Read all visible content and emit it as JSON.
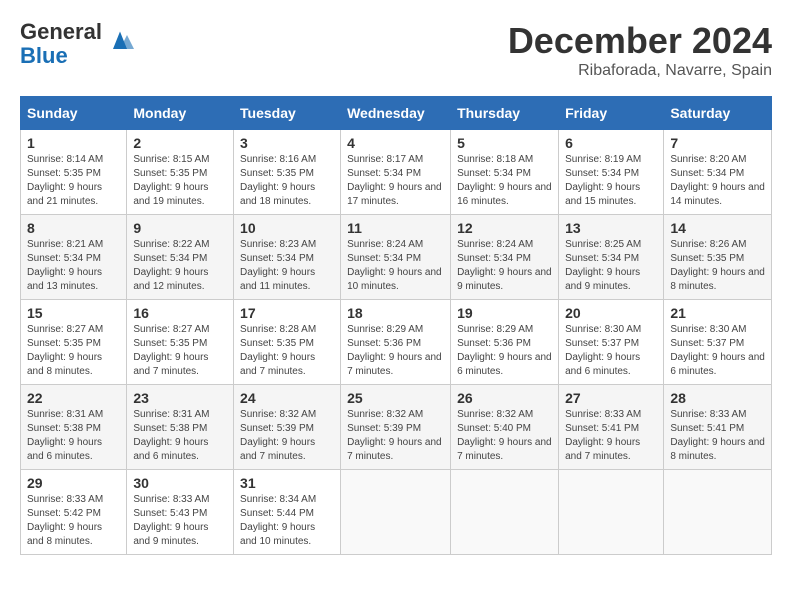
{
  "logo": {
    "general": "General",
    "blue": "Blue"
  },
  "title": "December 2024",
  "location": "Ribaforada, Navarre, Spain",
  "days_of_week": [
    "Sunday",
    "Monday",
    "Tuesday",
    "Wednesday",
    "Thursday",
    "Friday",
    "Saturday"
  ],
  "weeks": [
    [
      {
        "day": "1",
        "sunrise": "8:14 AM",
        "sunset": "5:35 PM",
        "daylight": "9 hours and 21 minutes."
      },
      {
        "day": "2",
        "sunrise": "8:15 AM",
        "sunset": "5:35 PM",
        "daylight": "9 hours and 19 minutes."
      },
      {
        "day": "3",
        "sunrise": "8:16 AM",
        "sunset": "5:35 PM",
        "daylight": "9 hours and 18 minutes."
      },
      {
        "day": "4",
        "sunrise": "8:17 AM",
        "sunset": "5:34 PM",
        "daylight": "9 hours and 17 minutes."
      },
      {
        "day": "5",
        "sunrise": "8:18 AM",
        "sunset": "5:34 PM",
        "daylight": "9 hours and 16 minutes."
      },
      {
        "day": "6",
        "sunrise": "8:19 AM",
        "sunset": "5:34 PM",
        "daylight": "9 hours and 15 minutes."
      },
      {
        "day": "7",
        "sunrise": "8:20 AM",
        "sunset": "5:34 PM",
        "daylight": "9 hours and 14 minutes."
      }
    ],
    [
      {
        "day": "8",
        "sunrise": "8:21 AM",
        "sunset": "5:34 PM",
        "daylight": "9 hours and 13 minutes."
      },
      {
        "day": "9",
        "sunrise": "8:22 AM",
        "sunset": "5:34 PM",
        "daylight": "9 hours and 12 minutes."
      },
      {
        "day": "10",
        "sunrise": "8:23 AM",
        "sunset": "5:34 PM",
        "daylight": "9 hours and 11 minutes."
      },
      {
        "day": "11",
        "sunrise": "8:24 AM",
        "sunset": "5:34 PM",
        "daylight": "9 hours and 10 minutes."
      },
      {
        "day": "12",
        "sunrise": "8:24 AM",
        "sunset": "5:34 PM",
        "daylight": "9 hours and 9 minutes."
      },
      {
        "day": "13",
        "sunrise": "8:25 AM",
        "sunset": "5:34 PM",
        "daylight": "9 hours and 9 minutes."
      },
      {
        "day": "14",
        "sunrise": "8:26 AM",
        "sunset": "5:35 PM",
        "daylight": "9 hours and 8 minutes."
      }
    ],
    [
      {
        "day": "15",
        "sunrise": "8:27 AM",
        "sunset": "5:35 PM",
        "daylight": "9 hours and 8 minutes."
      },
      {
        "day": "16",
        "sunrise": "8:27 AM",
        "sunset": "5:35 PM",
        "daylight": "9 hours and 7 minutes."
      },
      {
        "day": "17",
        "sunrise": "8:28 AM",
        "sunset": "5:35 PM",
        "daylight": "9 hours and 7 minutes."
      },
      {
        "day": "18",
        "sunrise": "8:29 AM",
        "sunset": "5:36 PM",
        "daylight": "9 hours and 7 minutes."
      },
      {
        "day": "19",
        "sunrise": "8:29 AM",
        "sunset": "5:36 PM",
        "daylight": "9 hours and 6 minutes."
      },
      {
        "day": "20",
        "sunrise": "8:30 AM",
        "sunset": "5:37 PM",
        "daylight": "9 hours and 6 minutes."
      },
      {
        "day": "21",
        "sunrise": "8:30 AM",
        "sunset": "5:37 PM",
        "daylight": "9 hours and 6 minutes."
      }
    ],
    [
      {
        "day": "22",
        "sunrise": "8:31 AM",
        "sunset": "5:38 PM",
        "daylight": "9 hours and 6 minutes."
      },
      {
        "day": "23",
        "sunrise": "8:31 AM",
        "sunset": "5:38 PM",
        "daylight": "9 hours and 6 minutes."
      },
      {
        "day": "24",
        "sunrise": "8:32 AM",
        "sunset": "5:39 PM",
        "daylight": "9 hours and 7 minutes."
      },
      {
        "day": "25",
        "sunrise": "8:32 AM",
        "sunset": "5:39 PM",
        "daylight": "9 hours and 7 minutes."
      },
      {
        "day": "26",
        "sunrise": "8:32 AM",
        "sunset": "5:40 PM",
        "daylight": "9 hours and 7 minutes."
      },
      {
        "day": "27",
        "sunrise": "8:33 AM",
        "sunset": "5:41 PM",
        "daylight": "9 hours and 7 minutes."
      },
      {
        "day": "28",
        "sunrise": "8:33 AM",
        "sunset": "5:41 PM",
        "daylight": "9 hours and 8 minutes."
      }
    ],
    [
      {
        "day": "29",
        "sunrise": "8:33 AM",
        "sunset": "5:42 PM",
        "daylight": "9 hours and 8 minutes."
      },
      {
        "day": "30",
        "sunrise": "8:33 AM",
        "sunset": "5:43 PM",
        "daylight": "9 hours and 9 minutes."
      },
      {
        "day": "31",
        "sunrise": "8:34 AM",
        "sunset": "5:44 PM",
        "daylight": "9 hours and 10 minutes."
      },
      null,
      null,
      null,
      null
    ]
  ]
}
